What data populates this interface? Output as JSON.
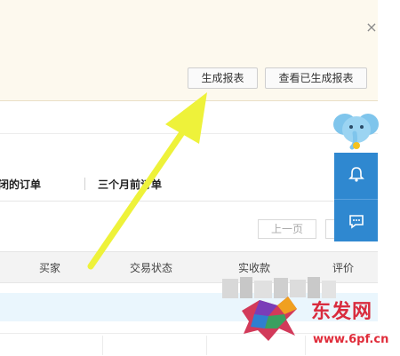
{
  "banner": {
    "generate_button": "生成报表",
    "view_generated_button": "查看已生成报表",
    "close_glyph": "×"
  },
  "tabs": {
    "closed_orders": "关闭的订单",
    "three_months_ago": "三个月前订单"
  },
  "pager": {
    "prev": "上一页"
  },
  "table_header": {
    "buyer": "买家",
    "trade_status": "交易状态",
    "paid_amount": "实收款",
    "review": "评价"
  },
  "side_tools": {
    "icons": [
      "elephant-mascot-icon",
      "bell-icon",
      "chat-icon"
    ],
    "accent_color": "#2f88d0"
  },
  "annotation": {
    "arrow_color": "#eef23a"
  },
  "watermark": {
    "site_name": "东发网",
    "url": "www.6pf.cn"
  }
}
